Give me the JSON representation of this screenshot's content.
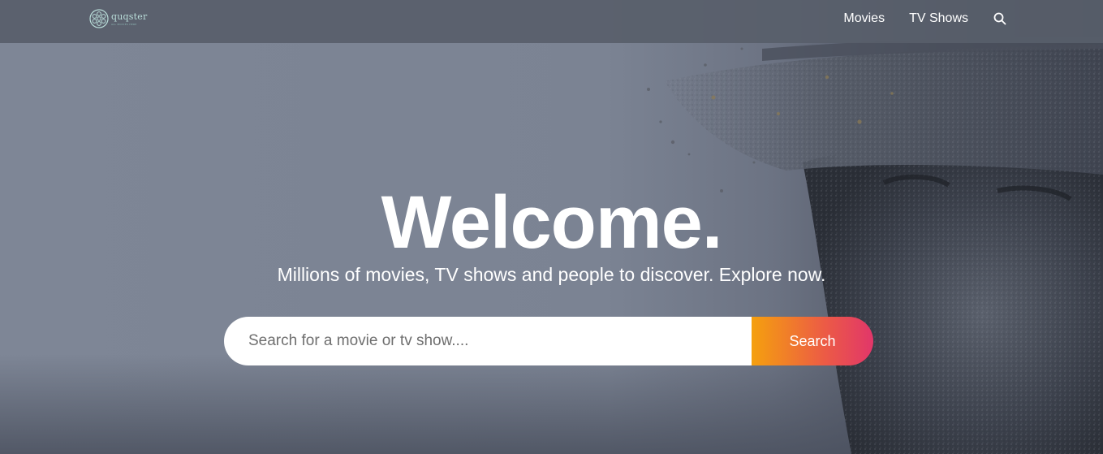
{
  "brand": {
    "name": "quqster",
    "tagline": "ALL MOVIES HERE",
    "accent_color": "#b9ddd9"
  },
  "nav": {
    "items": [
      {
        "label": "Movies"
      },
      {
        "label": "TV Shows"
      }
    ],
    "search_icon": "search-icon"
  },
  "hero": {
    "title": "Welcome.",
    "subtitle": "Millions of movies, TV shows and people to discover. Explore now.",
    "image": "soldier-helmet-illustration"
  },
  "search": {
    "placeholder": "Search for a movie or tv show....",
    "value": "",
    "button_label": "Search",
    "button_gradient": [
      "#f5a00e",
      "#e1366a"
    ]
  }
}
